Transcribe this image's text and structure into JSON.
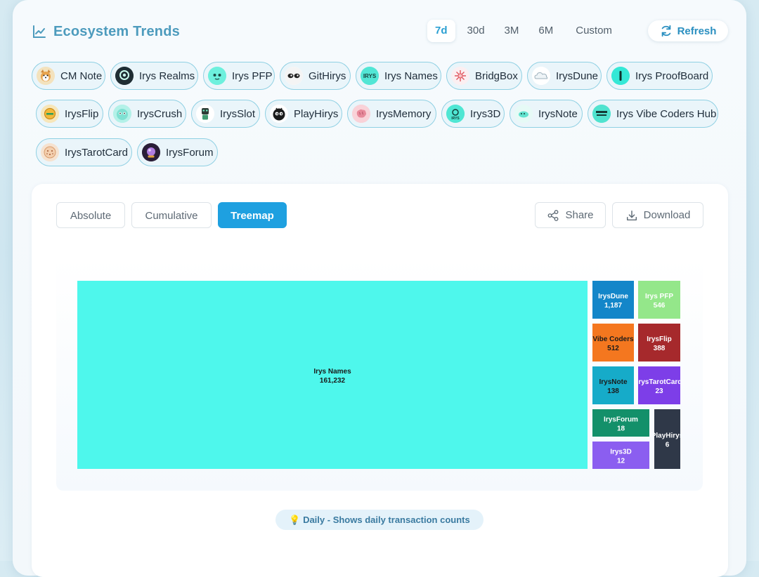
{
  "header": {
    "title": "Ecosystem Trends",
    "icon": "line-chart-icon"
  },
  "time_ranges": [
    "7d",
    "30d",
    "3M",
    "6M",
    "Custom"
  ],
  "active_range": "7d",
  "refresh_label": "Refresh",
  "projects": [
    {
      "label": "CM Note",
      "icon": "shiba-avatar-icon"
    },
    {
      "label": "Irys Realms",
      "icon": "realms-logo-icon"
    },
    {
      "label": "Irys PFP",
      "icon": "pfp-face-icon"
    },
    {
      "label": "GitHirys",
      "icon": "githirys-eyes-icon"
    },
    {
      "label": "Irys Names",
      "icon": "irys-names-logo-icon"
    },
    {
      "label": "BridgBox",
      "icon": "bridgbox-logo-icon"
    },
    {
      "label": "IrysDune",
      "icon": "cloud-icon"
    },
    {
      "label": "Irys ProofBoard",
      "icon": "proofboard-logo-icon"
    },
    {
      "label": "IrysFlip",
      "icon": "flip-coin-icon"
    },
    {
      "label": "IrysCrush",
      "icon": "crush-face-icon"
    },
    {
      "label": "IrysSlot",
      "icon": "slot-robot-icon"
    },
    {
      "label": "PlayHirys",
      "icon": "playhirys-face-icon"
    },
    {
      "label": "IrysMemory",
      "icon": "brain-icon"
    },
    {
      "label": "Irys3D",
      "icon": "irys3d-logo-icon"
    },
    {
      "label": "IrysNote",
      "icon": "note-bird-icon"
    },
    {
      "label": "Irys Vibe Coders Hub",
      "icon": "vibe-coders-logo-icon"
    },
    {
      "label": "IrysTarotCard",
      "icon": "tarot-card-icon"
    },
    {
      "label": "IrysForum",
      "icon": "crystal-ball-icon"
    }
  ],
  "view_tabs": [
    "Absolute",
    "Cumulative",
    "Treemap"
  ],
  "active_view": "Treemap",
  "actions": {
    "share": "Share",
    "download": "Download"
  },
  "hint": "💡 Daily - Shows daily transaction counts",
  "chart_data": {
    "type": "treemap",
    "items": [
      {
        "name": "Irys Names",
        "value": 161232,
        "display": "161,232",
        "color": "#4ef7ec",
        "text_color": "#1a1a1a"
      },
      {
        "name": "IrysDune",
        "value": 1187,
        "display": "1,187",
        "color": "#1386c9",
        "text_color": "#ffffff"
      },
      {
        "name": "Irys PFP",
        "value": 546,
        "display": "546",
        "color": "#94e78a",
        "text_color": "#ffffff"
      },
      {
        "name": "Vibe Coders",
        "value": 512,
        "display": "512",
        "color": "#f4771f",
        "text_color": "#1a1a1a"
      },
      {
        "name": "IrysFlip",
        "value": 388,
        "display": "388",
        "color": "#a6292c",
        "text_color": "#ffffff"
      },
      {
        "name": "IrysNote",
        "value": 138,
        "display": "138",
        "color": "#16abc9",
        "text_color": "#1a1a1a"
      },
      {
        "name": "IrysTarotCard",
        "value": 23,
        "display": "23",
        "color": "#7d3ee8",
        "text_color": "#ffffff"
      },
      {
        "name": "IrysForum",
        "value": 18,
        "display": "18",
        "color": "#13906a",
        "text_color": "#ffffff"
      },
      {
        "name": "Irys3D",
        "value": 12,
        "display": "12",
        "color": "#8b5ef0",
        "text_color": "#ffffff"
      },
      {
        "name": "PlayHirys",
        "value": 6,
        "display": "6",
        "color": "#2f3848",
        "text_color": "#ffffff"
      }
    ]
  }
}
